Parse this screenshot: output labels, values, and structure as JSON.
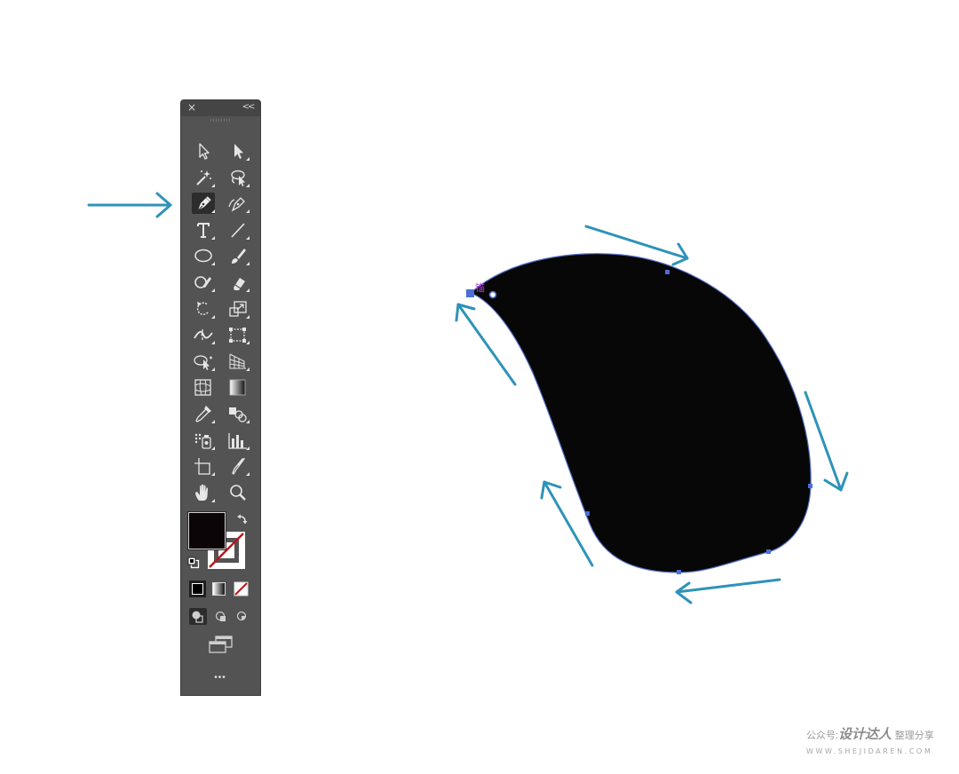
{
  "toolbar": {
    "close_glyph": "×",
    "collapse_glyph": "<<",
    "tools": [
      {
        "name": "selection-tool",
        "icon": "arrow-outline-icon"
      },
      {
        "name": "direct-selection-tool",
        "icon": "arrow-filled-icon"
      },
      {
        "name": "magic-wand-tool",
        "icon": "magic-wand-icon"
      },
      {
        "name": "lasso-tool",
        "icon": "lasso-icon"
      },
      {
        "name": "pen-tool",
        "icon": "pen-icon",
        "selected": true
      },
      {
        "name": "curvature-tool",
        "icon": "curvature-pen-icon"
      },
      {
        "name": "type-tool",
        "icon": "type-icon"
      },
      {
        "name": "line-segment-tool",
        "icon": "line-icon"
      },
      {
        "name": "ellipse-tool",
        "icon": "ellipse-icon"
      },
      {
        "name": "paintbrush-tool",
        "icon": "brush-icon"
      },
      {
        "name": "shaper-tool",
        "icon": "shaper-icon"
      },
      {
        "name": "eraser-tool",
        "icon": "eraser-icon"
      },
      {
        "name": "rotate-tool",
        "icon": "rotate-icon"
      },
      {
        "name": "scale-tool",
        "icon": "scale-icon"
      },
      {
        "name": "width-tool",
        "icon": "width-icon"
      },
      {
        "name": "free-transform-tool",
        "icon": "free-transform-icon"
      },
      {
        "name": "shape-builder-tool",
        "icon": "shape-builder-icon"
      },
      {
        "name": "perspective-grid-tool",
        "icon": "perspective-grid-icon"
      },
      {
        "name": "mesh-tool",
        "icon": "mesh-icon"
      },
      {
        "name": "gradient-tool",
        "icon": "gradient-icon"
      },
      {
        "name": "eyedropper-tool",
        "icon": "eyedropper-icon"
      },
      {
        "name": "blend-tool",
        "icon": "blend-icon"
      },
      {
        "name": "symbol-sprayer-tool",
        "icon": "symbol-sprayer-icon"
      },
      {
        "name": "column-graph-tool",
        "icon": "column-graph-icon"
      },
      {
        "name": "artboard-tool",
        "icon": "artboard-icon"
      },
      {
        "name": "slice-tool",
        "icon": "slice-icon"
      },
      {
        "name": "hand-tool",
        "icon": "hand-icon"
      },
      {
        "name": "zoom-tool",
        "icon": "zoom-icon"
      }
    ],
    "fill_color": "#0b0508",
    "stroke_color": "none",
    "more_glyph": "•••"
  },
  "annotation": {
    "arrow_color": "#2e93b8",
    "anchor_color": "#4a6fd6",
    "anchor_label": "锚"
  },
  "shape": {
    "fill_color": "#070708"
  },
  "watermark": {
    "prefix": "公众号:",
    "brand": "设计达人",
    "suffix": "整理分享",
    "url": "WWW.SHEJIDAREN.COM"
  }
}
